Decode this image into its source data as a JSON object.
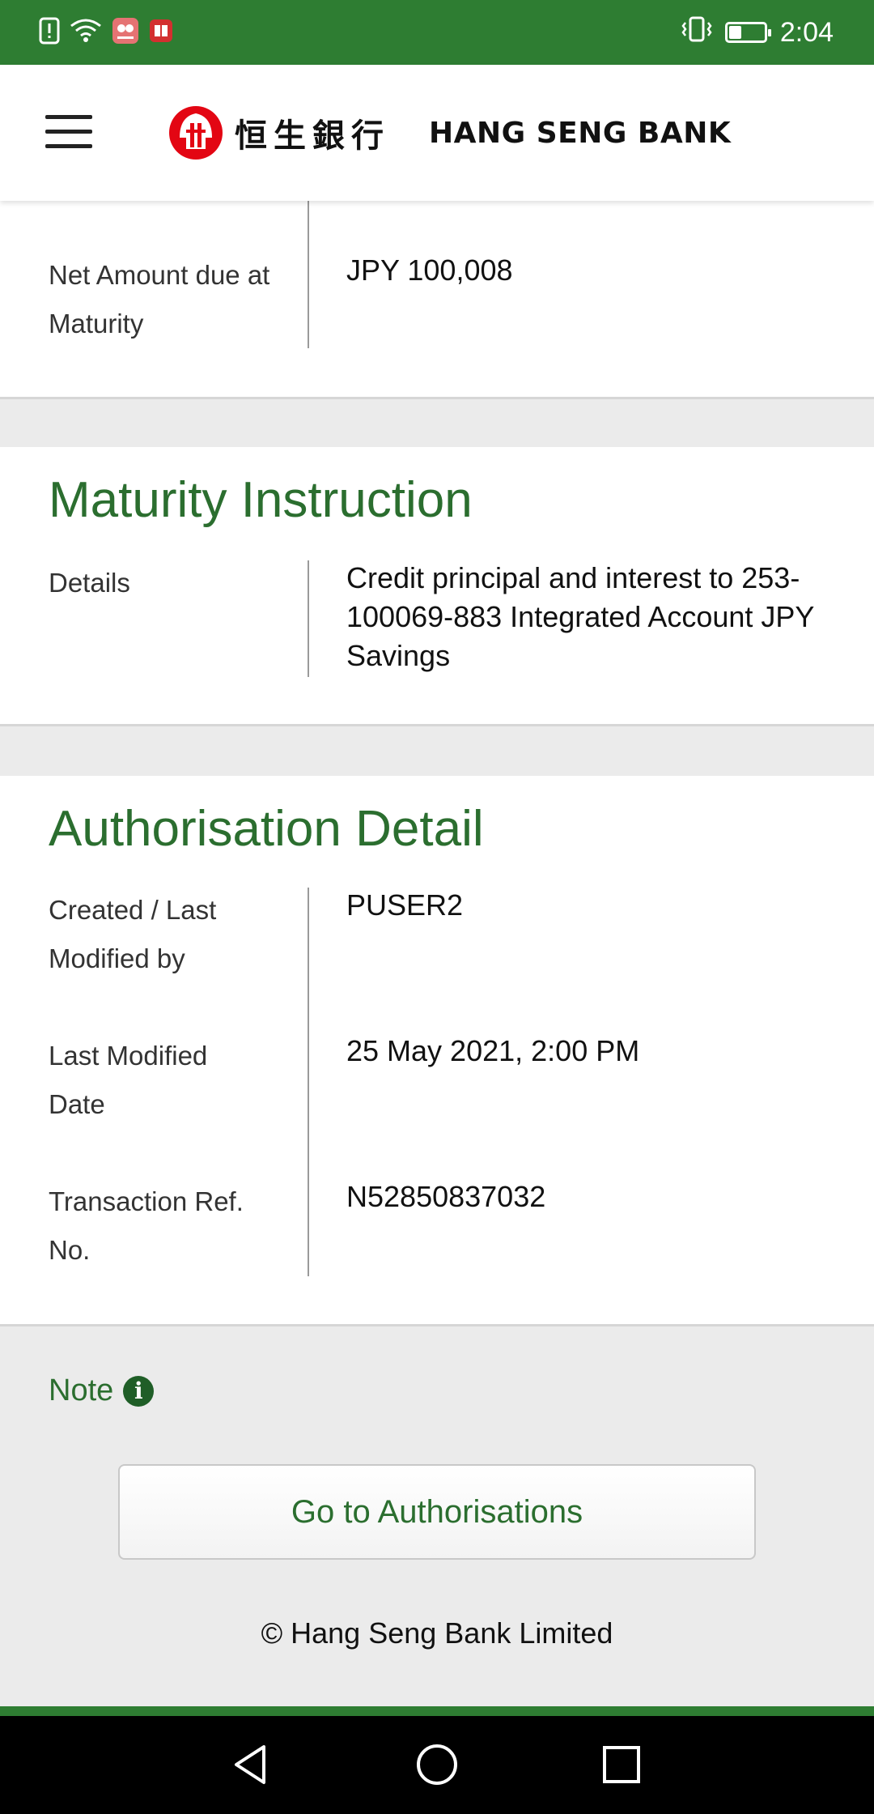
{
  "status_bar": {
    "time": "2:04",
    "battery_level": 0.35,
    "icons": [
      "alert-icon",
      "wifi-icon",
      "huawei-app-icon",
      "book-app-icon",
      "vibrate-icon",
      "battery-icon"
    ]
  },
  "header": {
    "menu_icon": "hamburger-menu-icon",
    "logo_cn": "恒生銀行",
    "logo_en": "HANG SENG BANK",
    "brand_color": "#2e7d32",
    "logo_color": "#e30613"
  },
  "net_amount": {
    "label": "Net Amount due at Maturity",
    "value": "JPY 100,008"
  },
  "maturity": {
    "title": "Maturity Instruction",
    "details_label": "Details",
    "details_value": "Credit principal and interest to 253-100069-883 Integrated Account JPY Savings"
  },
  "authorisation": {
    "title": "Authorisation Detail",
    "rows": [
      {
        "label": "Created / Last Modified by",
        "value": "PUSER2"
      },
      {
        "label": "Last Modified Date",
        "value": "25 May 2021, 2:00 PM"
      },
      {
        "label": "Transaction Ref. No.",
        "value": "N52850837032"
      }
    ]
  },
  "note": {
    "label": "Note",
    "icon": "info-icon"
  },
  "actions": {
    "go_authorisations": "Go to Authorisations"
  },
  "footer": {
    "copyright": "© Hang Seng Bank Limited"
  },
  "nav_bar": {
    "buttons": [
      "back-icon",
      "home-icon",
      "recents-icon"
    ]
  }
}
